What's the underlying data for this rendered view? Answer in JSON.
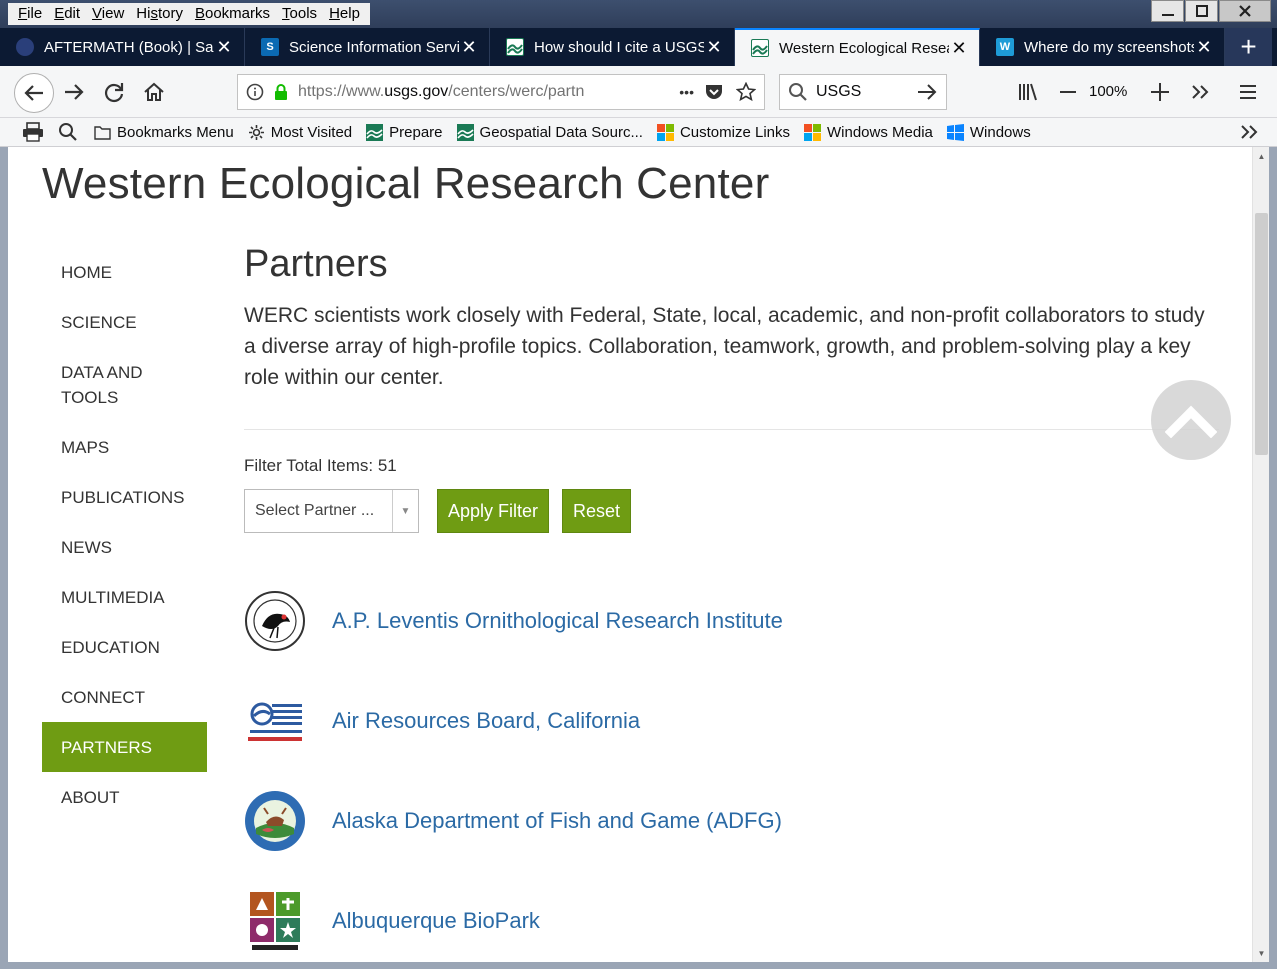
{
  "menu": [
    "File",
    "Edit",
    "View",
    "History",
    "Bookmarks",
    "Tools",
    "Help"
  ],
  "menu_access": [
    "F",
    "E",
    "V",
    "s",
    "B",
    "T",
    "H"
  ],
  "tabs": [
    {
      "title": "AFTERMATH (Book) | San",
      "active": false
    },
    {
      "title": "Science Information Servi",
      "active": false
    },
    {
      "title": "How should I cite a USGS",
      "active": false
    },
    {
      "title": "Western Ecological Resea",
      "active": true
    },
    {
      "title": "Where do my screenshots",
      "active": false
    }
  ],
  "urlbar": {
    "prefix": "https://www.",
    "domain": "usgs.gov",
    "path": "/centers/werc/partn",
    "more": "•••"
  },
  "search": {
    "value": "USGS"
  },
  "zoom": "100%",
  "bookmarks": [
    {
      "label": "Bookmarks Menu",
      "icon": "folder-icon"
    },
    {
      "label": "Most Visited",
      "icon": "gear-icon"
    },
    {
      "label": "Prepare",
      "icon": "usgs-icon"
    },
    {
      "label": "Geospatial Data Sourc...",
      "icon": "usgs-icon"
    },
    {
      "label": "Customize Links",
      "icon": "ms-icon"
    },
    {
      "label": "Windows Media",
      "icon": "ms-icon"
    },
    {
      "label": "Windows",
      "icon": "windows-icon"
    }
  ],
  "site": {
    "title": "Western Ecological Research Center"
  },
  "sidenav": [
    {
      "label": "HOME"
    },
    {
      "label": "SCIENCE"
    },
    {
      "label": "DATA AND TOOLS"
    },
    {
      "label": "MAPS"
    },
    {
      "label": "PUBLICATIONS"
    },
    {
      "label": "NEWS"
    },
    {
      "label": "MULTIMEDIA"
    },
    {
      "label": "EDUCATION"
    },
    {
      "label": "CONNECT"
    },
    {
      "label": "PARTNERS"
    },
    {
      "label": "ABOUT"
    }
  ],
  "main": {
    "heading": "Partners",
    "intro": "WERC scientists work closely with Federal, State, local, academic, and non-profit collaborators to study a diverse array of high-profile topics. Collaboration, teamwork, growth, and problem-solving play a key role within our center.",
    "filter_total": "Filter Total Items: 51",
    "select_value": "Select Partner ...",
    "apply_label": "Apply Filter",
    "reset_label": "Reset",
    "partners": [
      {
        "name": "A.P. Leventis Ornithological Research Institute"
      },
      {
        "name": "Air Resources Board, California"
      },
      {
        "name": "Alaska Department of Fish and Game (ADFG)"
      },
      {
        "name": "Albuquerque BioPark"
      }
    ]
  },
  "colors": {
    "accent_green": "#6f9c13",
    "link_blue": "#2b6aa5",
    "tab_bar": "#0c1a33"
  }
}
